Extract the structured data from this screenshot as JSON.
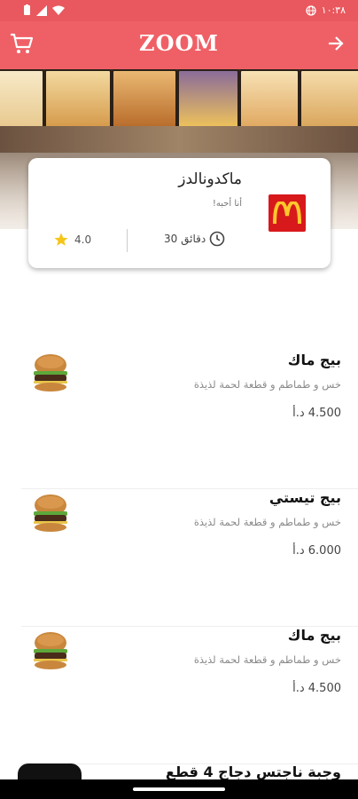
{
  "status_bar": {
    "time": "١٠:٣٨"
  },
  "app_bar": {
    "title": "ZOOM"
  },
  "restaurant": {
    "name": "ماكدونالدز",
    "tagline": "أنا أحبه!",
    "delivery_time": "30 دقائق",
    "rating": "4.0"
  },
  "menu_items": [
    {
      "title": "بيج ماك",
      "description": "خس و طماطم و قطعة لحمة لذيذة",
      "price": "4.500 د.أ"
    },
    {
      "title": "بيج تيستي",
      "description": "خس و طماطم و قطعة لحمة لذيذة",
      "price": "6.000 د.أ"
    },
    {
      "title": "بيج ماك",
      "description": "خس و طماطم و قطعة لحمة لذيذة",
      "price": "4.500 د.أ"
    }
  ],
  "partial_item": {
    "title": "وجبة ناجتس دجاج 4 قطع"
  },
  "colors": {
    "primary": "#ef6066",
    "status_bar": "#e8585e",
    "logo_red": "#d8191c",
    "logo_yellow": "#ffc72c",
    "star": "#f5c518"
  },
  "icons": {
    "cart": "cart-icon",
    "back": "arrow-right-icon",
    "clock": "clock-icon",
    "star": "star-icon",
    "globe": "globe-icon"
  }
}
